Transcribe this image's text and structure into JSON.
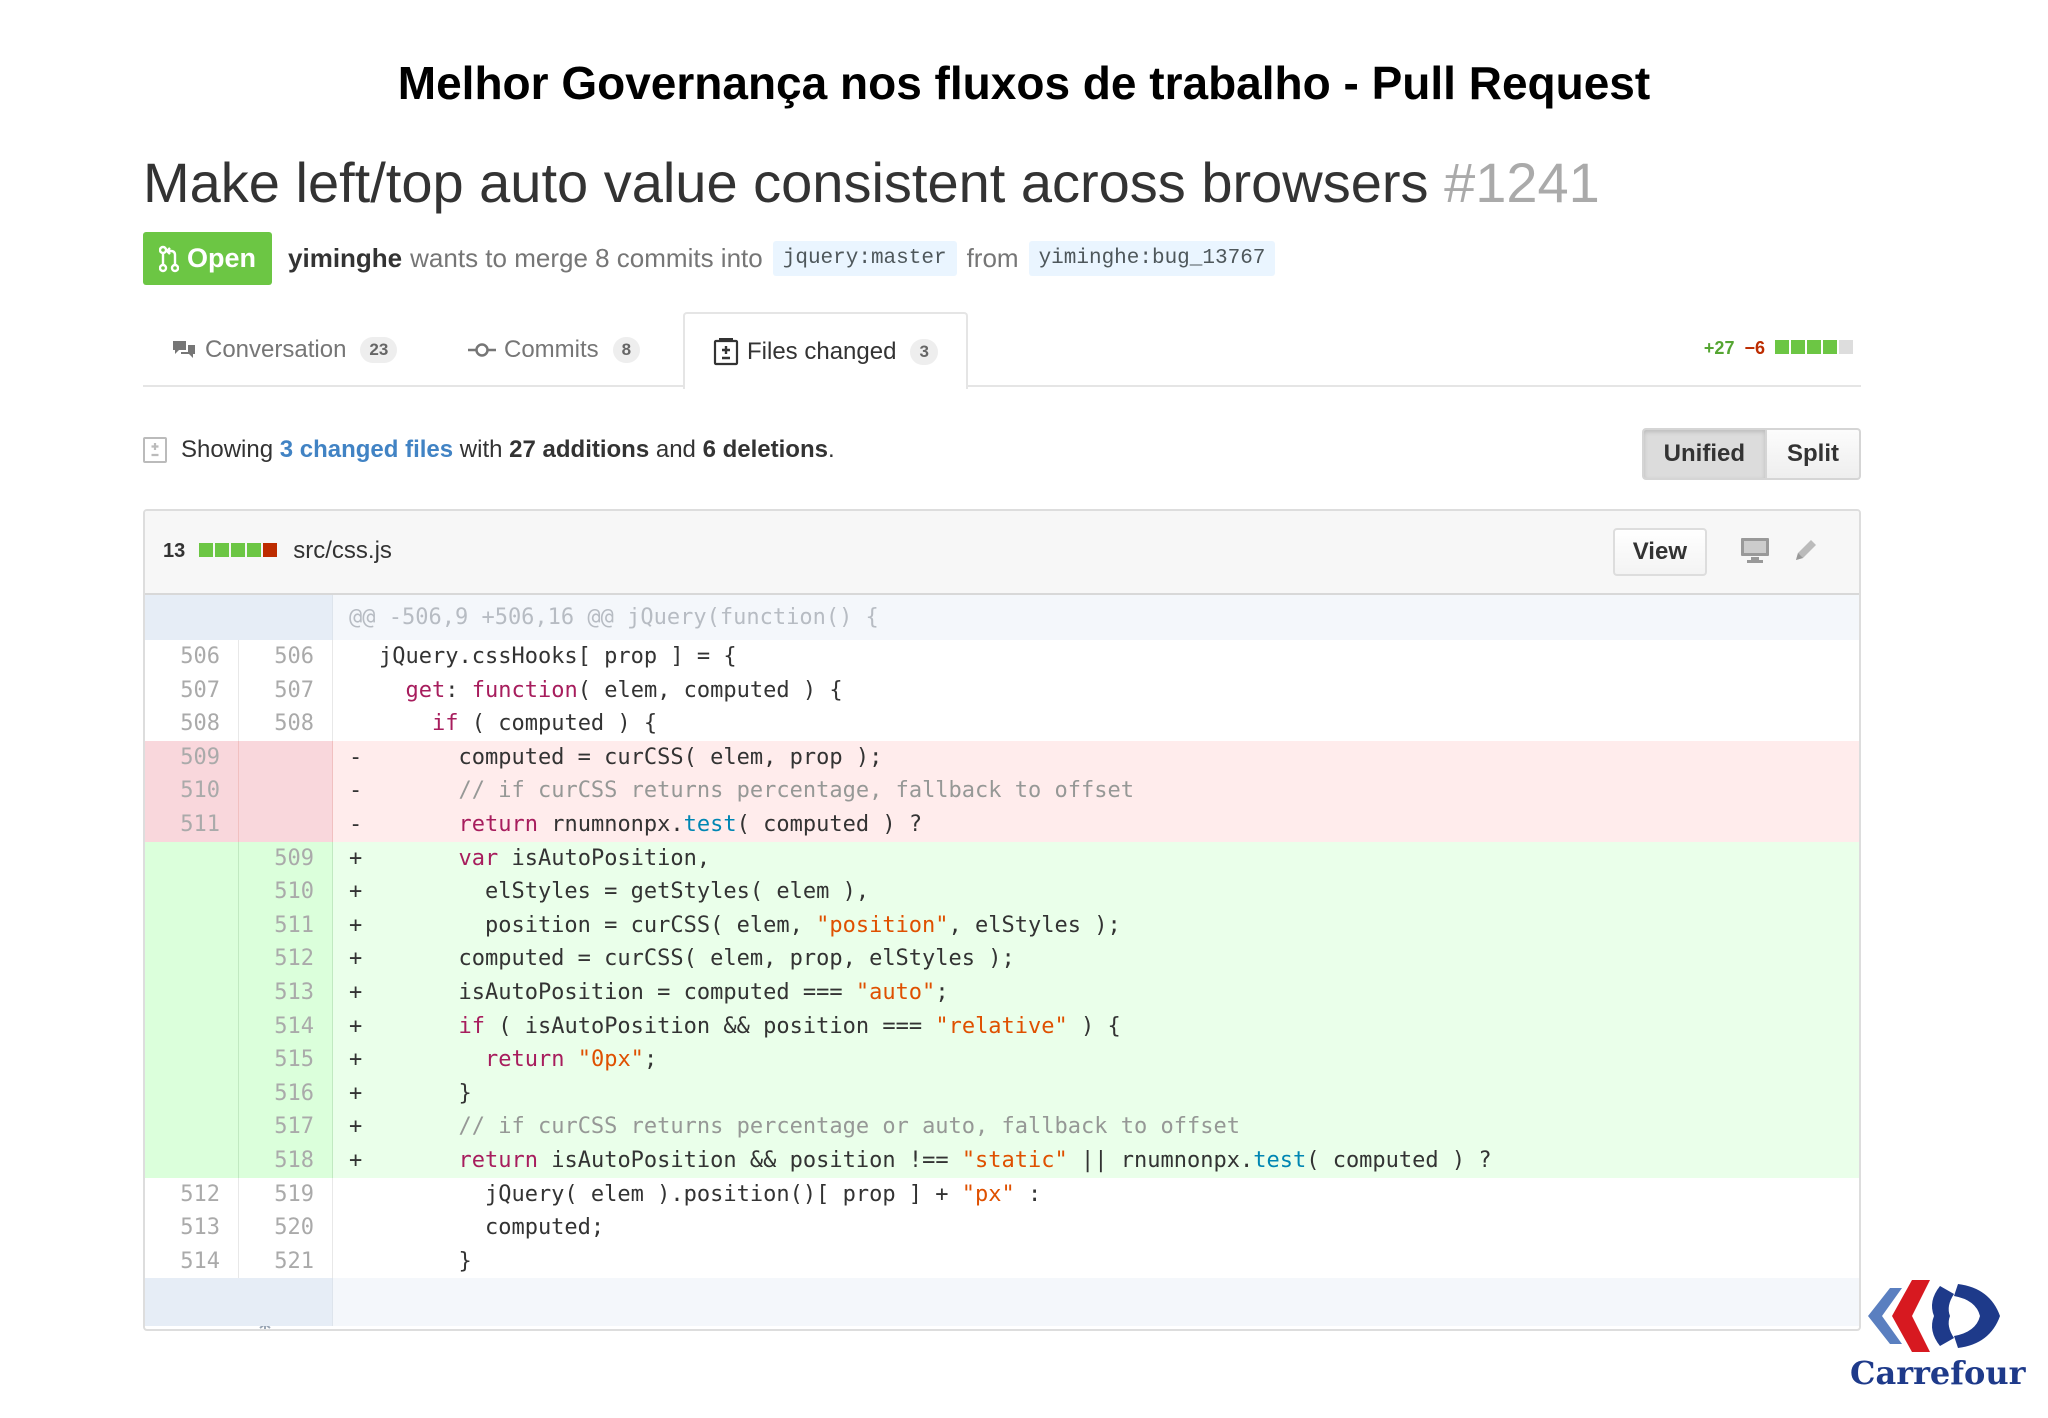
{
  "slide": {
    "title": "Melhor Governança nos fluxos de trabalho - Pull Request"
  },
  "pr": {
    "title": "Make left/top auto value consistent across browsers",
    "number": "#1241",
    "state": "Open",
    "author": "yiminghe",
    "merge_text": "wants to merge 8 commits into",
    "base_branch": "jquery:master",
    "from_text": "from",
    "head_branch": "yiminghe:bug_13767"
  },
  "tabs": [
    {
      "label": "Conversation",
      "count": "23",
      "icon": "comment-discussion-icon"
    },
    {
      "label": "Commits",
      "count": "8",
      "icon": "git-commit-icon"
    },
    {
      "label": "Files changed",
      "count": "3",
      "icon": "diff-icon"
    }
  ],
  "diffstat": {
    "additions": "+27",
    "deletions": "−6",
    "blocks": [
      "green",
      "green",
      "green",
      "green",
      "gray"
    ]
  },
  "toc": {
    "showing": "Showing",
    "files_link": "3 changed files",
    "with": "with",
    "additions": "27 additions",
    "and": "and",
    "deletions": "6 deletions",
    "end": "."
  },
  "view_toggle": {
    "unified": "Unified",
    "split": "Split",
    "selected": "Unified"
  },
  "file": {
    "change_count": "13",
    "blocks": [
      "green",
      "green",
      "green",
      "green",
      "red"
    ],
    "path": "src/css.js",
    "view_button": "View",
    "hunk_header": "@@ -506,9 +506,16 @@ jQuery(function() {"
  },
  "diff_lines": [
    {
      "type": "ctx",
      "old": "506",
      "new": "506",
      "sign": "",
      "code": "jQuery.cssHooks[ prop ] = {"
    },
    {
      "type": "ctx",
      "old": "507",
      "new": "507",
      "sign": "",
      "code": "  get: function( elem, computed ) {"
    },
    {
      "type": "ctx",
      "old": "508",
      "new": "508",
      "sign": "",
      "code": "    if ( computed ) {"
    },
    {
      "type": "del",
      "old": "509",
      "new": "",
      "sign": "-",
      "code": "      computed = curCSS( elem, prop );"
    },
    {
      "type": "del",
      "old": "510",
      "new": "",
      "sign": "-",
      "code": "      // if curCSS returns percentage, fallback to offset"
    },
    {
      "type": "del",
      "old": "511",
      "new": "",
      "sign": "-",
      "code": "      return rnumnonpx.test( computed ) ?"
    },
    {
      "type": "add",
      "old": "",
      "new": "509",
      "sign": "+",
      "code": "      var isAutoPosition,"
    },
    {
      "type": "add",
      "old": "",
      "new": "510",
      "sign": "+",
      "code": "        elStyles = getStyles( elem ),"
    },
    {
      "type": "add",
      "old": "",
      "new": "511",
      "sign": "+",
      "code": "        position = curCSS( elem, \"position\", elStyles );"
    },
    {
      "type": "add",
      "old": "",
      "new": "512",
      "sign": "+",
      "code": "      computed = curCSS( elem, prop, elStyles );"
    },
    {
      "type": "add",
      "old": "",
      "new": "513",
      "sign": "+",
      "code": "      isAutoPosition = computed === \"auto\";"
    },
    {
      "type": "add",
      "old": "",
      "new": "514",
      "sign": "+",
      "code": "      if ( isAutoPosition && position === \"relative\" ) {"
    },
    {
      "type": "add",
      "old": "",
      "new": "515",
      "sign": "+",
      "code": "        return \"0px\";"
    },
    {
      "type": "add",
      "old": "",
      "new": "516",
      "sign": "+",
      "code": "      }"
    },
    {
      "type": "add",
      "old": "",
      "new": "517",
      "sign": "+",
      "code": "      // if curCSS returns percentage or auto, fallback to offset"
    },
    {
      "type": "add",
      "old": "",
      "new": "518",
      "sign": "+",
      "code": "      return isAutoPosition && position !== \"static\" || rnumnonpx.test( computed ) ?"
    },
    {
      "type": "ctx",
      "old": "512",
      "new": "519",
      "sign": "",
      "code": "        jQuery( elem ).position()[ prop ] + \"px\" :"
    },
    {
      "type": "ctx",
      "old": "513",
      "new": "520",
      "sign": "",
      "code": "        computed;"
    },
    {
      "type": "ctx",
      "old": "514",
      "new": "521",
      "sign": "",
      "code": "      }"
    }
  ],
  "logo": {
    "text": "Carrefour"
  },
  "colors": {
    "open_badge": "#6cc644",
    "addition_bg": "#eaffea",
    "deletion_bg": "#ffecec",
    "link": "#4183c4",
    "logo_blue": "#1e3a8a",
    "logo_red": "#d71920"
  }
}
